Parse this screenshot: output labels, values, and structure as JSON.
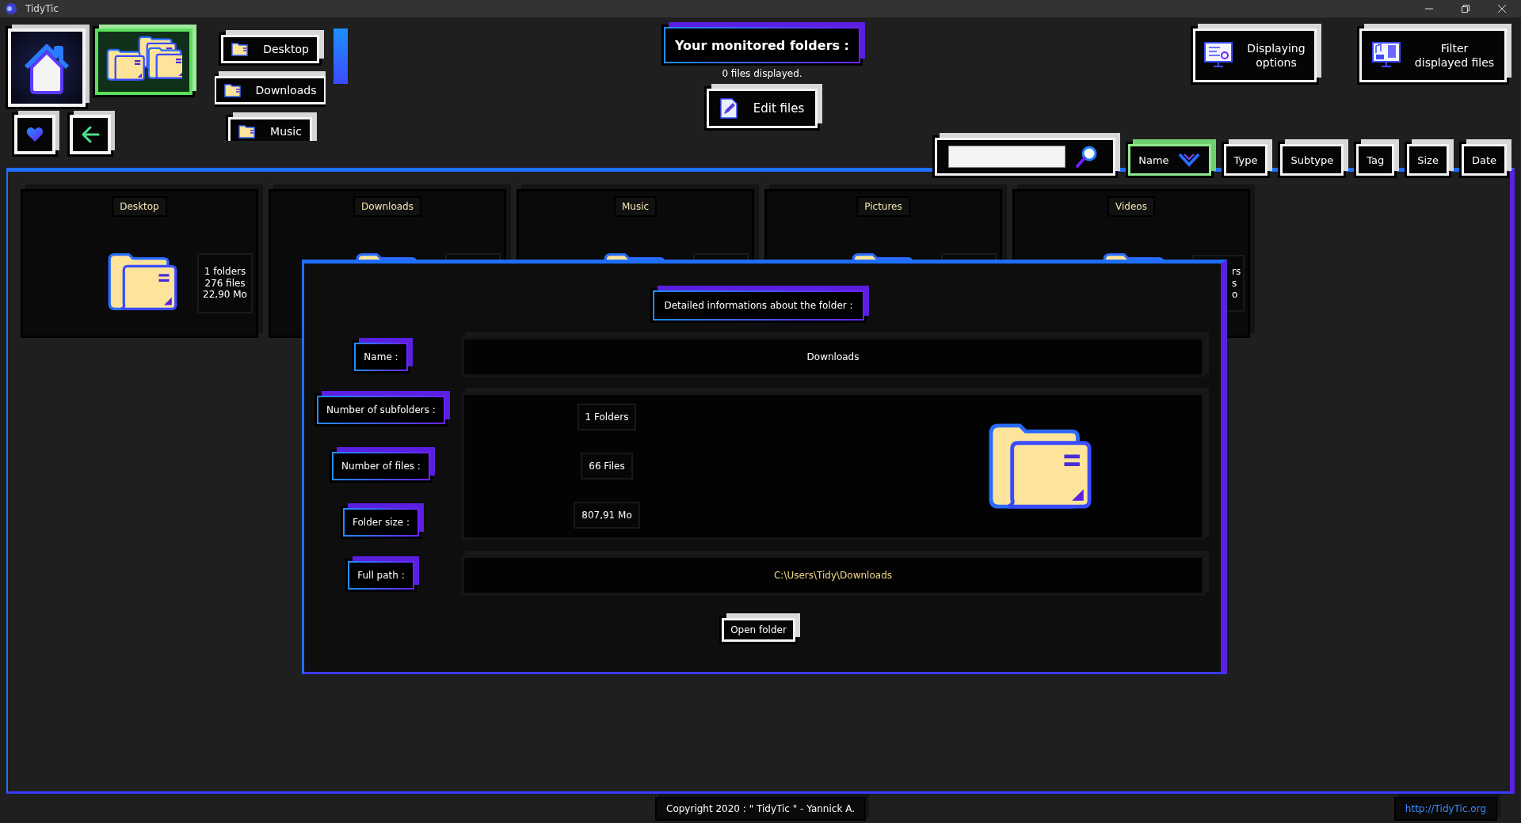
{
  "window": {
    "title": "TidyTic"
  },
  "nav_buttons": [
    {
      "kind": "home",
      "selected": false
    },
    {
      "kind": "folders",
      "selected": true
    }
  ],
  "small_buttons": [
    {
      "kind": "favorites"
    },
    {
      "kind": "back"
    }
  ],
  "shortcuts": [
    "Desktop",
    "Downloads",
    "Music"
  ],
  "header": {
    "title": "Your monitored folders :",
    "subtitle": "0 files displayed.",
    "edit_button": "Edit files"
  },
  "option_buttons": [
    {
      "kind": "display",
      "lines": [
        "Displaying",
        "options"
      ]
    },
    {
      "kind": "filter",
      "lines": [
        "Filter",
        "displayed files"
      ]
    }
  ],
  "sort_tabs": [
    {
      "label": "Name",
      "selected": true
    },
    {
      "label": "Type",
      "selected": false
    },
    {
      "label": "Subtype",
      "selected": false
    },
    {
      "label": "Tag",
      "selected": false
    },
    {
      "label": "Size",
      "selected": false
    },
    {
      "label": "Date",
      "selected": false
    }
  ],
  "folders": [
    {
      "name": "Desktop",
      "stats": [
        "1 folders",
        "276 files",
        "22,90 Mo"
      ]
    },
    {
      "name": "Downloads"
    },
    {
      "name": "Music"
    },
    {
      "name": "Pictures"
    },
    {
      "name": "Videos",
      "stats": [
        "rs",
        "s",
        "o"
      ]
    }
  ],
  "details": {
    "heading": "Detailed informations about the folder :",
    "name": {
      "label": "Name :",
      "value": "Downloads"
    },
    "stats": [
      {
        "label": "Number of subfolders :",
        "value": "1 Folders"
      },
      {
        "label": "Number of files :",
        "value": "66 Files"
      },
      {
        "label": "Folder size :",
        "value": "807,91 Mo"
      }
    ],
    "path": {
      "label": "Full path :",
      "value": "C:\\Users\\Tidy\\Downloads"
    },
    "button": "Open folder"
  },
  "footer": {
    "copyright": "Copyright 2020 : \" TidyTic \" - Yannick A.",
    "link": "http://TidyTic.org"
  }
}
